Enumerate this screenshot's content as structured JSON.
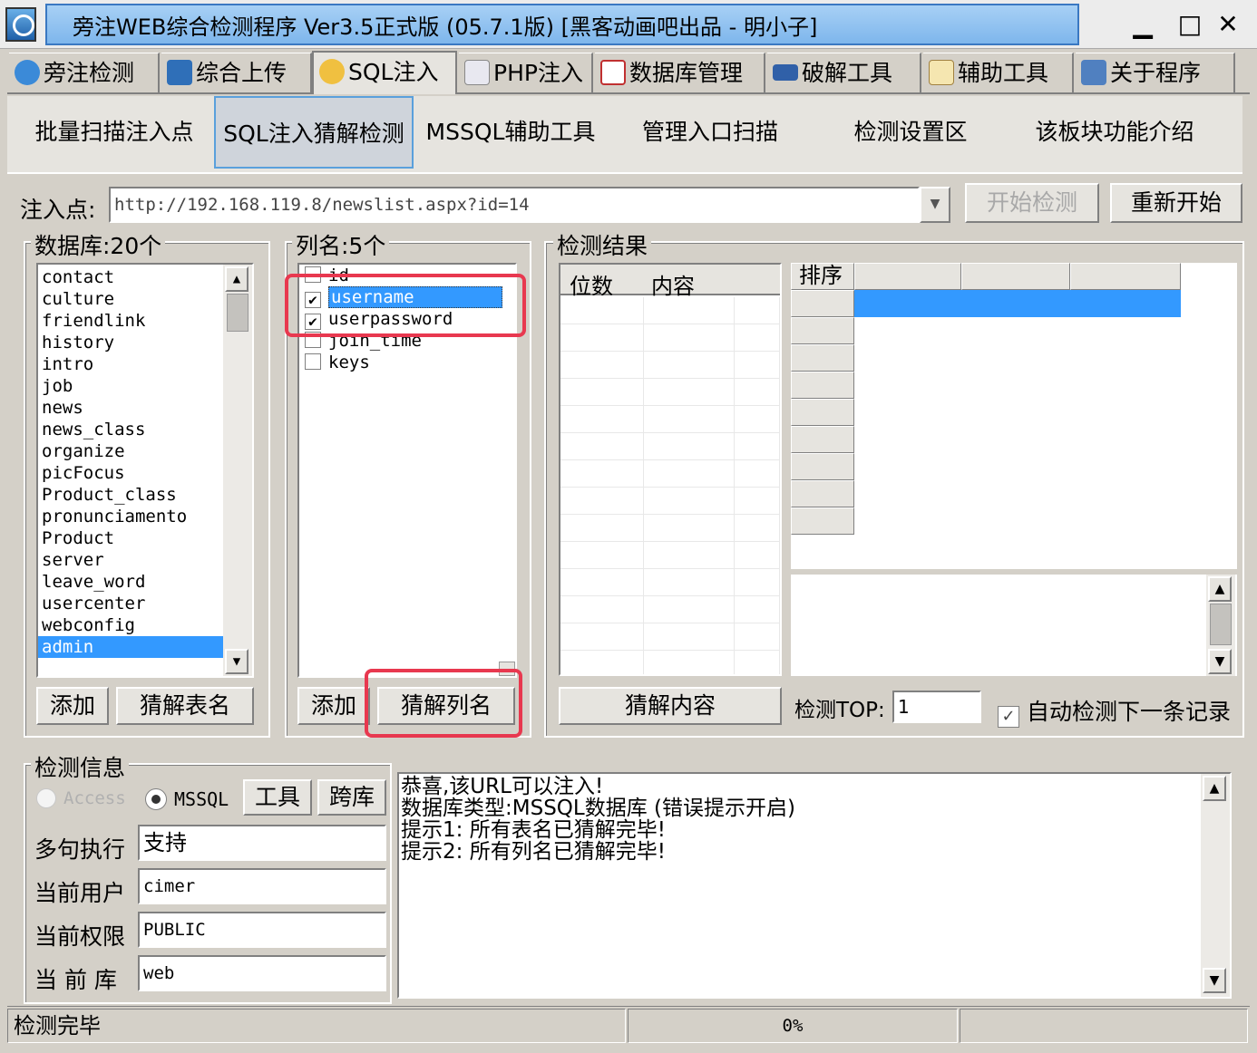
{
  "window": {
    "title": "旁注WEB综合检测程序 Ver3.5正式版 (05.7.1版) [黑客动画吧出品 - 明小子]",
    "minimize": "▁",
    "maximize": "□",
    "close": "✕"
  },
  "main_tabs": [
    {
      "label": "旁注检测",
      "icon": "magnifier-globe-icon",
      "active": false
    },
    {
      "label": "综合上传",
      "icon": "chart-upload-icon",
      "active": false
    },
    {
      "label": "SQL注入",
      "icon": "magnifier-db-icon",
      "active": true
    },
    {
      "label": "PHP注入",
      "icon": "document-search-icon",
      "active": false
    },
    {
      "label": "数据库管理",
      "icon": "db-manage-icon",
      "active": false
    },
    {
      "label": "破解工具",
      "icon": "crack-tool-icon",
      "active": false
    },
    {
      "label": "辅助工具",
      "icon": "clipboard-icon",
      "active": false
    },
    {
      "label": "关于程序",
      "icon": "book-icon",
      "active": false
    }
  ],
  "sub_tabs": [
    {
      "label": "批量扫描注入点",
      "active": false
    },
    {
      "label": "SQL注入猜解检测",
      "active": true
    },
    {
      "label": "MSSQL辅助工具",
      "active": false
    },
    {
      "label": "管理入口扫描",
      "active": false
    },
    {
      "label": "检测设置区",
      "active": false
    },
    {
      "label": "该板块功能介绍",
      "active": false
    }
  ],
  "inject": {
    "label": "注入点:",
    "url": "http://192.168.119.8/newslist.aspx?id=14",
    "start_btn": "开始检测",
    "restart_btn": "重新开始"
  },
  "databases": {
    "legend": "数据库:20个",
    "items": [
      "contact",
      "culture",
      "friendlink",
      "history",
      "intro",
      "job",
      "news",
      "news_class",
      "organize",
      "picFocus",
      "Product_class",
      "pronunciamento",
      "Product",
      "server",
      "leave_word",
      "usercenter",
      "webconfig",
      "admin"
    ],
    "selected": "admin",
    "add_btn": "添加",
    "guess_btn": "猜解表名"
  },
  "columns": {
    "legend": "列名:5个",
    "items": [
      {
        "name": "id",
        "checked": false
      },
      {
        "name": "username",
        "checked": true
      },
      {
        "name": "userpassword",
        "checked": true
      },
      {
        "name": "join_time",
        "checked": false
      },
      {
        "name": "keys",
        "checked": false
      }
    ],
    "checkmark": "✔",
    "add_btn": "添加",
    "guess_btn": "猜解列名"
  },
  "results": {
    "legend": "检测结果",
    "col_digits": "位数",
    "col_content": "内容",
    "sort_header": "排序",
    "guess_content_btn": "猜解内容",
    "top_label": "检测TOP:",
    "top_value": "1",
    "auto_next_label": "自动检测下一条记录",
    "auto_next_checked": true
  },
  "info": {
    "legend": "检测信息",
    "radio_access": "Access",
    "radio_mssql": "MSSQL",
    "tools_btn": "工具",
    "cross_db_btn": "跨库",
    "multi_exec_label": "多句执行",
    "multi_exec_value": "支持",
    "current_user_label": "当前用户",
    "current_user_value": "cimer",
    "current_perm_label": "当前权限",
    "current_perm_value": "PUBLIC",
    "current_db_label": "当 前 库",
    "current_db_value": "web",
    "messages": [
      "恭喜,该URL可以注入!",
      "数据库类型:MSSQL数据库 (错误提示开启)",
      "提示1: 所有表名已猜解完毕!",
      "提示2: 所有列名已猜解完毕!"
    ]
  },
  "status": {
    "text": "检测完毕",
    "progress": "0%"
  },
  "colors": {
    "selection": "#3399ff",
    "highlight_box": "#e8384f",
    "title_blue": "#7eb6ec"
  }
}
